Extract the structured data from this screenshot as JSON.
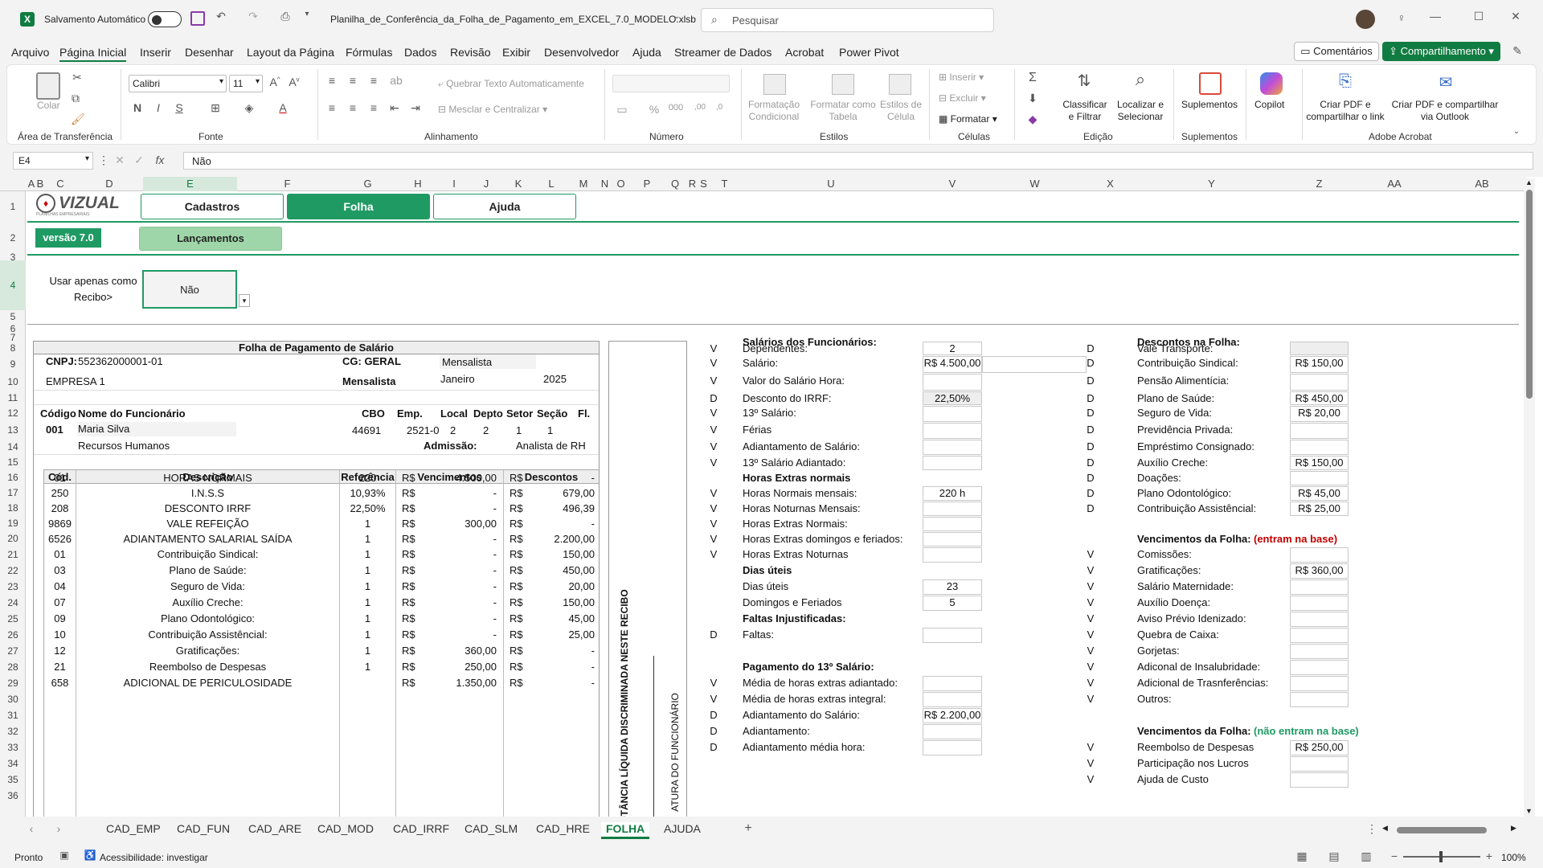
{
  "title_bar": {
    "app_icon": "excel-icon",
    "autosave_label": "Salvamento Automático",
    "filename": "Planilha_de_Conferência_da_Folha_de_Pagamento_em_EXCEL_7.0_MODELO.xlsb",
    "search_placeholder": "Pesquisar"
  },
  "menu": [
    "Arquivo",
    "Página Inicial",
    "Inserir",
    "Desenhar",
    "Layout da Página",
    "Fórmulas",
    "Dados",
    "Revisão",
    "Exibir",
    "Desenvolvedor",
    "Ajuda",
    "Streamer de Dados",
    "Acrobat",
    "Power Pivot"
  ],
  "menu_right": {
    "comments": "Comentários",
    "share": "Compartilhamento"
  },
  "ribbon": {
    "paste": "Colar",
    "clipboard": "Área de Transferência",
    "font_name": "Calibri",
    "font_size": "11",
    "font_group": "Fonte",
    "wrap_text": "Quebrar Texto Automaticamente",
    "merge": "Mesclar e Centralizar",
    "alignment_group": "Alinhamento",
    "number_group": "Número",
    "cond_format": "Formatação Condicional",
    "format_table": "Formatar como Tabela",
    "cell_styles": "Estilos de Célula",
    "styles_group": "Estilos",
    "insert": "Inserir",
    "delete": "Excluir",
    "format": "Formatar",
    "cells_group": "Células",
    "sort_filter": "Classificar e Filtrar",
    "find_select": "Localizar e Selecionar",
    "editing_group": "Edição",
    "addins": "Suplementos",
    "addins_group": "Suplementos",
    "copilot": "Copilot",
    "pdf_link": "Criar PDF e compartilhar o link",
    "pdf_outlook": "Criar PDF e compartilhar via Outlook",
    "acrobat_group": "Adobe Acrobat"
  },
  "formula_bar": {
    "cell_ref": "E4",
    "value": "Não"
  },
  "columns": [
    "A",
    "B",
    "C",
    "D",
    "E",
    "F",
    "G",
    "H",
    "I",
    "J",
    "K",
    "L",
    "M",
    "N",
    "O",
    "P",
    "Q",
    "R",
    "S",
    "T",
    "U",
    "V",
    "W",
    "X",
    "Y",
    "Z",
    "AA",
    "AB"
  ],
  "rows": [
    "1",
    "2",
    "3",
    "4",
    "5",
    "6",
    "7",
    "8",
    "9",
    "10",
    "11",
    "12",
    "13",
    "14",
    "15",
    "16",
    "17",
    "18",
    "19",
    "20",
    "21",
    "22",
    "23",
    "24",
    "25",
    "26",
    "27",
    "28",
    "29",
    "30",
    "31",
    "32",
    "33",
    "34",
    "35",
    "36"
  ],
  "nav": {
    "logo": "VIZUAL",
    "logo_sub": "PLANILHAS EMPRESARIAIS",
    "version": "versão 7.0",
    "btn_cadastros": "Cadastros",
    "btn_folha": "Folha",
    "btn_ajuda": "Ajuda",
    "btn_lancamentos": "Lançamentos"
  },
  "recibo": {
    "label1": "Usar apenas como",
    "label2": "Recibo>",
    "value": "Não"
  },
  "payslip": {
    "title": "Folha de Pagamento de Salário",
    "cnpj_label": "CNPJ:",
    "cnpj": "552362000001-01",
    "cg": "CG: GERAL",
    "tipo1": "Mensalista",
    "empresa": "EMPRESA 1",
    "tipo2": "Mensalista",
    "mes": "Janeiro",
    "ano": "2025",
    "h_codigo": "Código",
    "h_nome": "Nome do Funcionário",
    "h_cbo": "CBO",
    "h_emp": "Emp.",
    "h_local": "Local",
    "h_depto": "Depto",
    "h_setor": "Setor",
    "h_secao": "Seção",
    "h_fl": "Fl.",
    "codigo": "001",
    "nome": "Maria Silva",
    "cbo": "44691",
    "emp": "2521-0",
    "local": "2",
    "depto": "2",
    "setor": "1",
    "secao": "1",
    "depto_nome": "Recursos Humanos",
    "admissao_label": "Admissão:",
    "cargo": "Analista de RH",
    "t_cod": "Cód.",
    "t_desc": "Descrição",
    "t_ref": "Referência",
    "t_venc": "Vencimentos",
    "t_desc2": "Descontos",
    "items": [
      {
        "cod": "01",
        "desc": "HORAS NORMAIS",
        "ref": "220",
        "rs1": "R$",
        "venc": "4.500,00",
        "rs2": "R$",
        "descv": "-"
      },
      {
        "cod": "250",
        "desc": "I.N.S.S",
        "ref": "10,93%",
        "rs1": "R$",
        "venc": "-",
        "rs2": "R$",
        "descv": "679,00"
      },
      {
        "cod": "208",
        "desc": "DESCONTO IRRF",
        "ref": "22,50%",
        "rs1": "R$",
        "venc": "-",
        "rs2": "R$",
        "descv": "496,39"
      },
      {
        "cod": "9869",
        "desc": "VALE REFEIÇÃO",
        "ref": "1",
        "rs1": "R$",
        "venc": "300,00",
        "rs2": "R$",
        "descv": "-"
      },
      {
        "cod": "6526",
        "desc": "ADIANTAMENTO SALARIAL SAÍDA",
        "ref": "1",
        "rs1": "R$",
        "venc": "-",
        "rs2": "R$",
        "descv": "2.200,00"
      },
      {
        "cod": "01",
        "desc": "Contribuição Sindical:",
        "ref": "1",
        "rs1": "R$",
        "venc": "-",
        "rs2": "R$",
        "descv": "150,00"
      },
      {
        "cod": "03",
        "desc": "Plano de Saúde:",
        "ref": "1",
        "rs1": "R$",
        "venc": "-",
        "rs2": "R$",
        "descv": "450,00"
      },
      {
        "cod": "04",
        "desc": "Seguro de Vida:",
        "ref": "1",
        "rs1": "R$",
        "venc": "-",
        "rs2": "R$",
        "descv": "20,00"
      },
      {
        "cod": "07",
        "desc": "Auxílio Creche:",
        "ref": "1",
        "rs1": "R$",
        "venc": "-",
        "rs2": "R$",
        "descv": "150,00"
      },
      {
        "cod": "09",
        "desc": "Plano Odontológico:",
        "ref": "1",
        "rs1": "R$",
        "venc": "-",
        "rs2": "R$",
        "descv": "45,00"
      },
      {
        "cod": "10",
        "desc": "Contribuição Assistêncial:",
        "ref": "1",
        "rs1": "R$",
        "venc": "-",
        "rs2": "R$",
        "descv": "25,00"
      },
      {
        "cod": "12",
        "desc": "Gratificações:",
        "ref": "1",
        "rs1": "R$",
        "venc": "360,00",
        "rs2": "R$",
        "descv": "-"
      },
      {
        "cod": "21",
        "desc": "Reembolso de Despesas",
        "ref": "1",
        "rs1": "R$",
        "venc": "250,00",
        "rs2": "R$",
        "descv": "-"
      },
      {
        "cod": "658",
        "desc": "ADICIONAL DE PERICULOSIDADE",
        "ref": "",
        "rs1": "R$",
        "venc": "1.350,00",
        "rs2": "R$",
        "descv": "-"
      }
    ],
    "vertical1": "POTÂNCIA LÍQUIDA DISCRIMINADA NESTE RECIBO",
    "vertical2": "ATURA DO FUNCIONÁRIO"
  },
  "mid": {
    "sec1": "Salários dos Funcionários:",
    "rows1": [
      {
        "t": "V",
        "label": "Dependentes:",
        "val": "2"
      },
      {
        "t": "V",
        "label": "Salário:",
        "val": "R$ 4.500,00"
      },
      {
        "t": "V",
        "label": "Valor do Salário Hora:",
        "val": ""
      },
      {
        "t": "D",
        "label": "Desconto do IRRF:",
        "val": "22,50%"
      },
      {
        "t": "V",
        "label": "13º Salário:",
        "val": ""
      },
      {
        "t": "V",
        "label": "Férias",
        "val": ""
      },
      {
        "t": "V",
        "label": "Adiantamento de Salário:",
        "val": ""
      },
      {
        "t": "V",
        "label": "13º Salário Adiantado:",
        "val": ""
      }
    ],
    "sec2": "Horas Extras normais",
    "rows2": [
      {
        "t": "V",
        "label": "Horas Normais mensais:",
        "val": "220 h"
      },
      {
        "t": "V",
        "label": "Horas Noturnas Mensais:",
        "val": ""
      },
      {
        "t": "V",
        "label": "Horas Extras Normais:",
        "val": ""
      },
      {
        "t": "V",
        "label": "Horas Extras domingos e feriados:",
        "val": ""
      },
      {
        "t": "V",
        "label": "Horas Extras Noturnas",
        "val": ""
      }
    ],
    "sec3": "Dias úteis",
    "rows3": [
      {
        "t": "",
        "label": "Dias úteis",
        "val": "23"
      },
      {
        "t": "",
        "label": "Domingos e Feriados",
        "val": "5"
      }
    ],
    "sec4": "Faltas Injustificadas:",
    "rows4": [
      {
        "t": "D",
        "label": "Faltas:",
        "val": ""
      }
    ],
    "sec5": "Pagamento do 13º Salário:",
    "rows5": [
      {
        "t": "V",
        "label": "Média de horas extras adiantado:",
        "val": ""
      },
      {
        "t": "V",
        "label": "Média de horas extras integral:",
        "val": ""
      },
      {
        "t": "D",
        "label": "Adiantamento do Salário:",
        "val": "R$ 2.200,00"
      },
      {
        "t": "D",
        "label": "Adiantamento:",
        "val": ""
      },
      {
        "t": "D",
        "label": "Adiantamento média hora:",
        "val": ""
      }
    ]
  },
  "right": {
    "sec1": "Descontos na Folha:",
    "rows1": [
      {
        "t": "D",
        "label": "Vale Transporte:",
        "val": ""
      },
      {
        "t": "D",
        "label": "Contribuição Sindical:",
        "val": "R$ 150,00"
      },
      {
        "t": "D",
        "label": "Pensão Alimentícia:",
        "val": ""
      },
      {
        "t": "D",
        "label": "Plano de Saúde:",
        "val": "R$ 450,00"
      },
      {
        "t": "D",
        "label": "Seguro de Vida:",
        "val": "R$ 20,00"
      },
      {
        "t": "D",
        "label": "Previdência Privada:",
        "val": ""
      },
      {
        "t": "D",
        "label": "Empréstimo Consignado:",
        "val": ""
      },
      {
        "t": "D",
        "label": "Auxílio Creche:",
        "val": "R$ 150,00"
      },
      {
        "t": "D",
        "label": "Doações:",
        "val": ""
      },
      {
        "t": "D",
        "label": "Plano Odontológico:",
        "val": "R$ 45,00"
      },
      {
        "t": "D",
        "label": "Contribuição Assistêncial:",
        "val": "R$ 25,00"
      }
    ],
    "sec2": "Vencimentos da Folha:",
    "sec2_note": "(entram na base)",
    "rows2": [
      {
        "t": "V",
        "label": "Comissões:",
        "val": ""
      },
      {
        "t": "V",
        "label": "Gratificações:",
        "val": "R$ 360,00"
      },
      {
        "t": "V",
        "label": "Salário Maternidade:",
        "val": ""
      },
      {
        "t": "V",
        "label": "Auxílio Doença:",
        "val": ""
      },
      {
        "t": "V",
        "label": "Aviso Prévio Idenizado:",
        "val": ""
      },
      {
        "t": "V",
        "label": "Quebra de Caixa:",
        "val": ""
      },
      {
        "t": "V",
        "label": "Gorjetas:",
        "val": ""
      },
      {
        "t": "V",
        "label": "Adiconal de Insalubridade:",
        "val": ""
      },
      {
        "t": "V",
        "label": "Adicional de Trasnferências:",
        "val": ""
      },
      {
        "t": "V",
        "label": "Outros:",
        "val": ""
      }
    ],
    "sec3": "Vencimentos da Folha:",
    "sec3_note": "(não entram na base)",
    "rows3": [
      {
        "t": "V",
        "label": "Reembolso de Despesas",
        "val": "R$ 250,00"
      },
      {
        "t": "V",
        "label": "Participação nos Lucros",
        "val": ""
      },
      {
        "t": "V",
        "label": "Ajuda de Custo",
        "val": ""
      }
    ]
  },
  "tabs": [
    "CAD_EMP",
    "CAD_FUN",
    "CAD_ARE",
    "CAD_MOD",
    "CAD_IRRF",
    "CAD_SLM",
    "CAD_HRE",
    "FOLHA",
    "AJUDA"
  ],
  "active_tab": "FOLHA",
  "status": {
    "ready": "Pronto",
    "accessibility": "Acessibilidade: investigar",
    "zoom": "100%"
  },
  "colors": {
    "excel_green": "#107c41",
    "brand_green": "#1f9a63",
    "active_btn": "#1f9a63",
    "light_green": "#9fd6a9",
    "red_note": "#c00000",
    "green_note": "#1f9a63"
  }
}
